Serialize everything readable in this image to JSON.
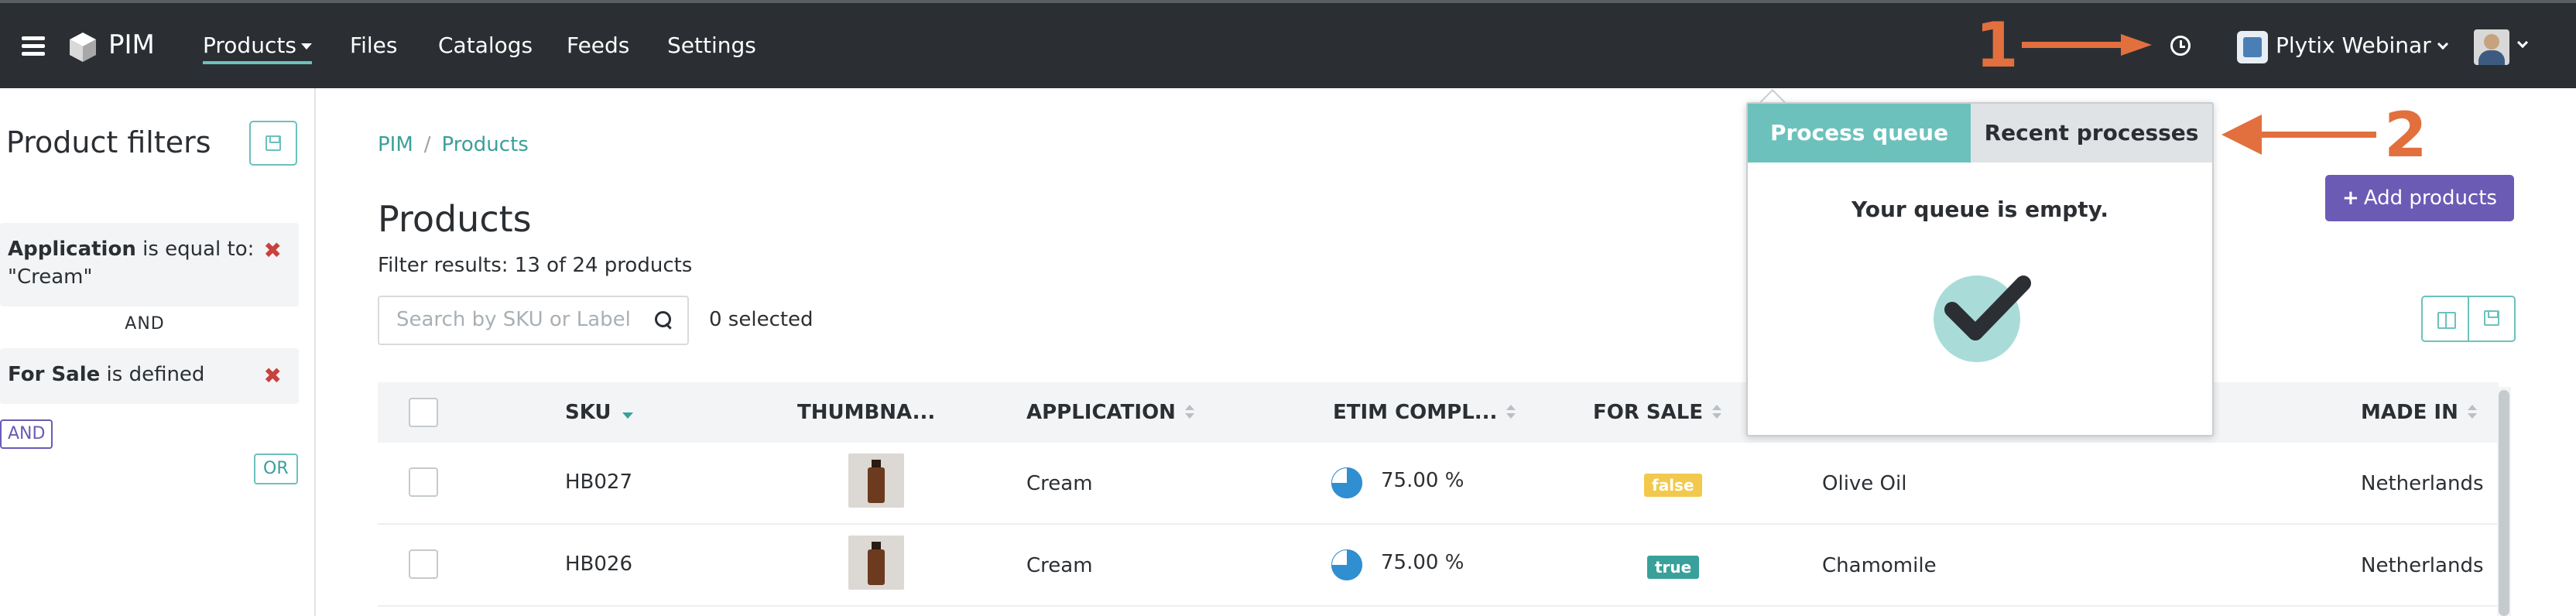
{
  "navbar": {
    "brand": "PIM",
    "items": [
      "Products",
      "Files",
      "Catalogs",
      "Feeds",
      "Settings"
    ],
    "account_name": "Plytix Webinar",
    "icons": {
      "menu": "hamburger-menu-icon",
      "logo": "cube-logo-icon",
      "processes": "clock-icon",
      "account": "account-logo-icon",
      "user": "user-avatar"
    }
  },
  "annotations": {
    "first": "1",
    "second": "2",
    "color": "#e2703e"
  },
  "filters": {
    "title": "Product filters",
    "rules": [
      {
        "attribute": "Application",
        "operator": "is equal to:",
        "value": "\"Cream\""
      },
      {
        "attribute": "For Sale",
        "operator": "is defined",
        "value": ""
      }
    ],
    "connector": "AND",
    "and_button": "AND",
    "or_button": "OR",
    "remove_glyph": "✖"
  },
  "breadcrumb": {
    "root": "PIM",
    "separator": "/",
    "current": "Products"
  },
  "page": {
    "title": "Products",
    "filter_results": "Filter results: 13 of 24 products",
    "selected": "0 selected",
    "add_button": "Add products"
  },
  "search": {
    "placeholder": "Search by SKU or Label"
  },
  "table": {
    "columns": [
      "SKU",
      "THUMBNA...",
      "APPLICATION",
      "ETIM COMPL...",
      "FOR SALE",
      "MADE IN"
    ],
    "rows": [
      {
        "sku": "HB027",
        "application": "Cream",
        "etim": "75.00 %",
        "etim_fraction": 0.75,
        "for_sale": "false",
        "label": "Olive Oil",
        "made_in": "Netherlands"
      },
      {
        "sku": "HB026",
        "application": "Cream",
        "etim": "75.00 %",
        "etim_fraction": 0.75,
        "for_sale": "true",
        "label": "Chamomile",
        "made_in": "Netherlands"
      }
    ]
  },
  "process_queue": {
    "tabs": [
      "Process queue",
      "Recent processes"
    ],
    "empty_message": "Your queue is empty."
  },
  "colors": {
    "navbar": "#2b2f33",
    "accent": "#6cc1bc",
    "primary_button": "#6b5bb5",
    "badge_false": "#f2c94c",
    "badge_true": "#3aa09a",
    "remove": "#c8413c",
    "progress": "#2f8fd0"
  }
}
